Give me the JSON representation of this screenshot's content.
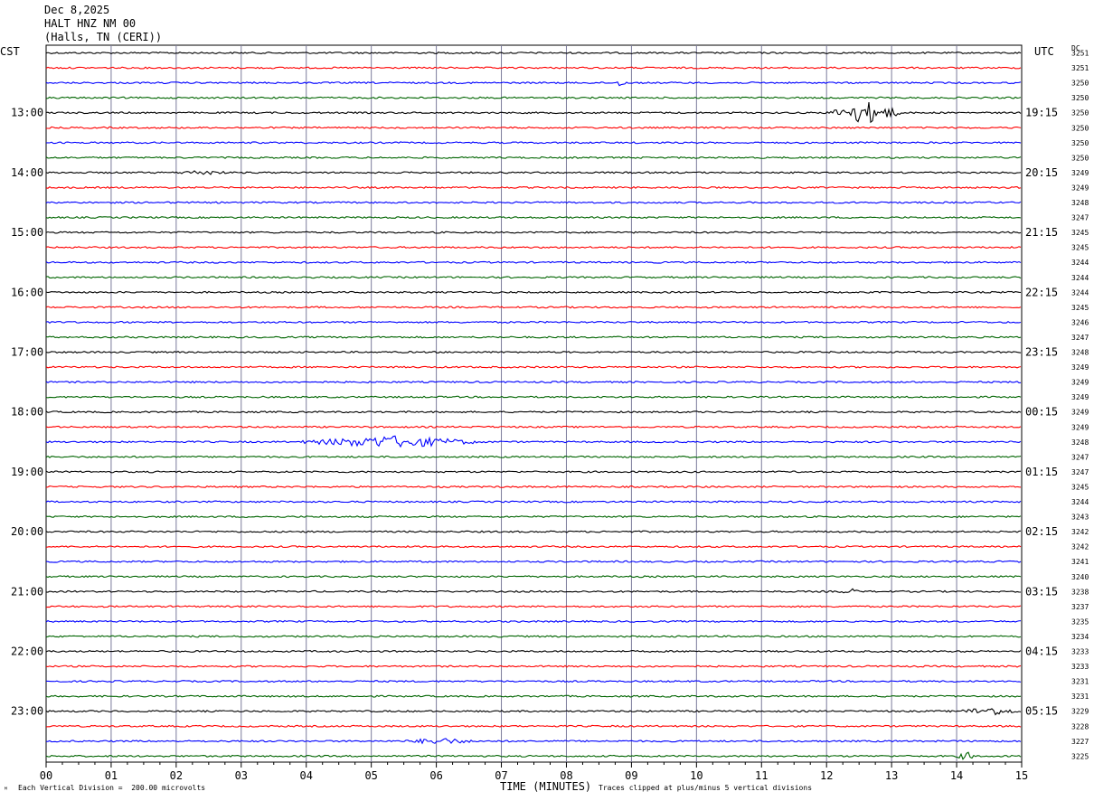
{
  "header": {
    "date": "Dec 8,2025",
    "station": "HALT HNZ NM 00",
    "location": "(Halls, TN (CERI))"
  },
  "left_label": "CST",
  "right_label": "UTC",
  "dc_label": "DC",
  "chart_data": {
    "type": "line",
    "title": "HALT HNZ NM 00",
    "xlabel": "TIME (MINUTES)",
    "ylabel": "",
    "xlim": [
      0,
      15
    ],
    "x_ticks": [
      "00",
      "01",
      "02",
      "03",
      "04",
      "05",
      "06",
      "07",
      "08",
      "09",
      "10",
      "11",
      "12",
      "13",
      "14",
      "15"
    ],
    "trace_count": 48,
    "trace_colors": [
      "#000000",
      "#ff0000",
      "#0000ff",
      "#006400"
    ],
    "cst_hour_labels": [
      "13:00",
      "14:00",
      "15:00",
      "16:00",
      "17:00",
      "18:00",
      "19:00",
      "20:00",
      "21:00",
      "22:00",
      "23:00"
    ],
    "utc_hour_labels": [
      "19:15",
      "20:15",
      "21:15",
      "22:15",
      "23:15",
      "00:15",
      "01:15",
      "02:15",
      "03:15",
      "04:15",
      "05:15"
    ],
    "dc_offsets": [
      "3251",
      "3251",
      "3250",
      "3250",
      "3250",
      "3250",
      "3250",
      "3250",
      "3249",
      "3249",
      "3248",
      "3247",
      "3245",
      "3245",
      "3244",
      "3244",
      "3244",
      "3245",
      "3246",
      "3247",
      "3248",
      "3249",
      "3249",
      "3249",
      "3249",
      "3249",
      "3248",
      "3247",
      "3247",
      "3245",
      "3244",
      "3243",
      "3242",
      "3242",
      "3241",
      "3240",
      "3238",
      "3237",
      "3235",
      "3234",
      "3233",
      "3233",
      "3231",
      "3231",
      "3229",
      "3228",
      "3227",
      "3225"
    ],
    "events": [
      {
        "trace": 4,
        "start_min": 12.0,
        "end_min": 13.2,
        "amp": 12
      },
      {
        "trace": 2,
        "start_min": 8.7,
        "end_min": 8.95,
        "amp": 3
      },
      {
        "trace": 26,
        "start_min": 3.8,
        "end_min": 6.8,
        "amp": 6
      },
      {
        "trace": 36,
        "start_min": 12.2,
        "end_min": 12.5,
        "amp": 3
      },
      {
        "trace": 44,
        "start_min": 14.0,
        "end_min": 15.0,
        "amp": 4
      },
      {
        "trace": 47,
        "start_min": 14.0,
        "end_min": 14.3,
        "amp": 4
      },
      {
        "trace": 46,
        "start_min": 5.5,
        "end_min": 6.6,
        "amp": 3
      },
      {
        "trace": 8,
        "start_min": 2.0,
        "end_min": 2.8,
        "amp": 2
      }
    ]
  },
  "footer": {
    "vertical_division": "Each Vertical Division =  200.00 microvolts",
    "clip_note": "Traces clipped at plus/minus 5 vertical divisions"
  }
}
